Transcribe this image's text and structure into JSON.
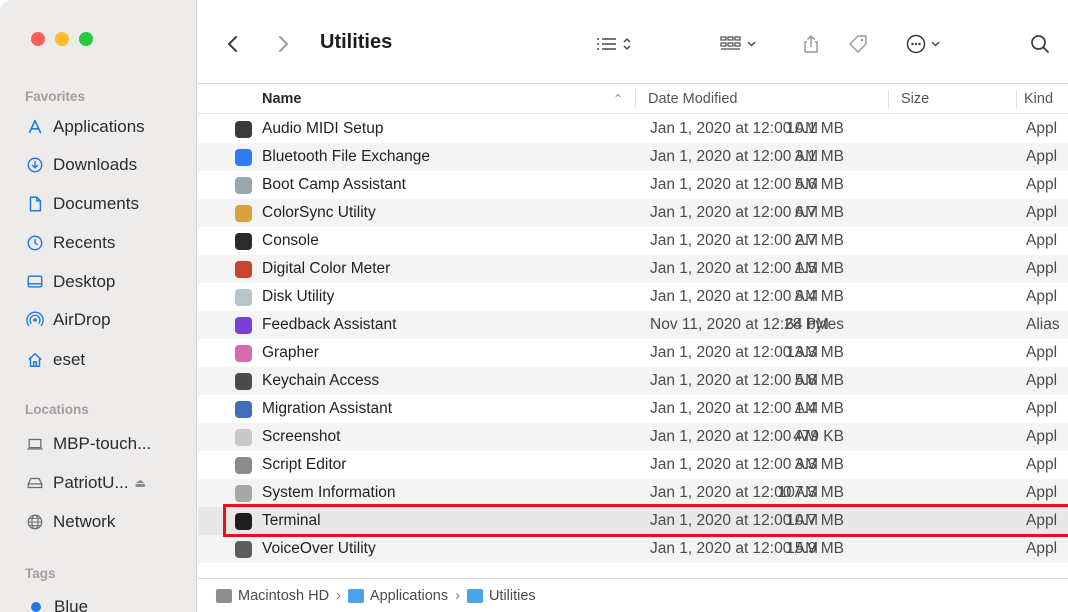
{
  "toolbar": {
    "title": "Utilities",
    "back_icon": "chevron-left-icon",
    "forward_icon": "chevron-right-icon",
    "view_icon": "list-view-icon",
    "group_icon": "grid-group-icon",
    "share_icon": "share-icon",
    "tag_icon": "tag-icon",
    "more_icon": "more-ellipsis-icon",
    "search_icon": "search-icon"
  },
  "sidebar": {
    "favorites_title": "Favorites",
    "favorites": [
      {
        "label": "Applications",
        "icon": "applications-icon"
      },
      {
        "label": "Downloads",
        "icon": "downloads-icon"
      },
      {
        "label": "Documents",
        "icon": "documents-icon"
      },
      {
        "label": "Recents",
        "icon": "recents-icon"
      },
      {
        "label": "Desktop",
        "icon": "desktop-icon"
      },
      {
        "label": "AirDrop",
        "icon": "airdrop-icon"
      },
      {
        "label": "eset",
        "icon": "home-icon"
      }
    ],
    "locations_title": "Locations",
    "locations": [
      {
        "label": "MBP-touch...",
        "icon": "laptop-icon"
      },
      {
        "label": "PatriotU...",
        "icon": "drive-icon"
      },
      {
        "label": "Network",
        "icon": "network-icon"
      }
    ],
    "tags_title": "Tags",
    "tags": [
      {
        "label": "Blue",
        "color": "#1f7ae0"
      }
    ]
  },
  "columns": {
    "name": "Name",
    "date": "Date Modified",
    "size": "Size",
    "kind": "Kind"
  },
  "files": [
    {
      "name": "Audio MIDI Setup",
      "date": "Jan 1, 2020 at 12:00 AM",
      "size": "10.1 MB",
      "kind": "Appl",
      "color": "#3a3a3c"
    },
    {
      "name": "Bluetooth File Exchange",
      "date": "Jan 1, 2020 at 12:00 AM",
      "size": "3.1 MB",
      "kind": "Appl",
      "color": "#2f7bf2"
    },
    {
      "name": "Boot Camp Assistant",
      "date": "Jan 1, 2020 at 12:00 AM",
      "size": "5.6 MB",
      "kind": "Appl",
      "color": "#9aa6ad"
    },
    {
      "name": "ColorSync Utility",
      "date": "Jan 1, 2020 at 12:00 AM",
      "size": "6.7 MB",
      "kind": "Appl",
      "color": "#d9a23a"
    },
    {
      "name": "Console",
      "date": "Jan 1, 2020 at 12:00 AM",
      "size": "2.7 MB",
      "kind": "Appl",
      "color": "#2b2b2b"
    },
    {
      "name": "Digital Color Meter",
      "date": "Jan 1, 2020 at 12:00 AM",
      "size": "1.5 MB",
      "kind": "Appl",
      "color": "#c9442c"
    },
    {
      "name": "Disk Utility",
      "date": "Jan 1, 2020 at 12:00 AM",
      "size": "8.4 MB",
      "kind": "Appl",
      "color": "#b8c4cc"
    },
    {
      "name": "Feedback Assistant",
      "date": "Nov 11, 2020 at 12:28 PM",
      "size": "64 bytes",
      "kind": "Alias",
      "color": "#7b3fd6"
    },
    {
      "name": "Grapher",
      "date": "Jan 1, 2020 at 12:00 AM",
      "size": "13.3 MB",
      "kind": "Appl",
      "color": "#d66bb0"
    },
    {
      "name": "Keychain Access",
      "date": "Jan 1, 2020 at 12:00 AM",
      "size": "5.8 MB",
      "kind": "Appl",
      "color": "#4a4a4a"
    },
    {
      "name": "Migration Assistant",
      "date": "Jan 1, 2020 at 12:00 AM",
      "size": "1.4 MB",
      "kind": "Appl",
      "color": "#3f6fb8"
    },
    {
      "name": "Screenshot",
      "date": "Jan 1, 2020 at 12:00 AM",
      "size": "479 KB",
      "kind": "Appl",
      "color": "#c8c8c8"
    },
    {
      "name": "Script Editor",
      "date": "Jan 1, 2020 at 12:00 AM",
      "size": "3.3 MB",
      "kind": "Appl",
      "color": "#8b8b8b"
    },
    {
      "name": "System Information",
      "date": "Jan 1, 2020 at 12:00 AM",
      "size": "107.3 MB",
      "kind": "Appl",
      "color": "#a7a7a7"
    },
    {
      "name": "Terminal",
      "date": "Jan 1, 2020 at 12:00 AM",
      "size": "10.7 MB",
      "kind": "Appl",
      "color": "#1e1e1e"
    },
    {
      "name": "VoiceOver Utility",
      "date": "Jan 1, 2020 at 12:00 AM",
      "size": "15.9 MB",
      "kind": "Appl",
      "color": "#5c5c5c"
    }
  ],
  "pathbar": {
    "items": [
      {
        "label": "Macintosh HD",
        "color": "#8e8e93"
      },
      {
        "label": "Applications",
        "color": "#4aa3e8"
      },
      {
        "label": "Utilities",
        "color": "#4aa3e8"
      }
    ]
  },
  "highlight": {
    "row": "Terminal",
    "color": "#e5141a"
  }
}
